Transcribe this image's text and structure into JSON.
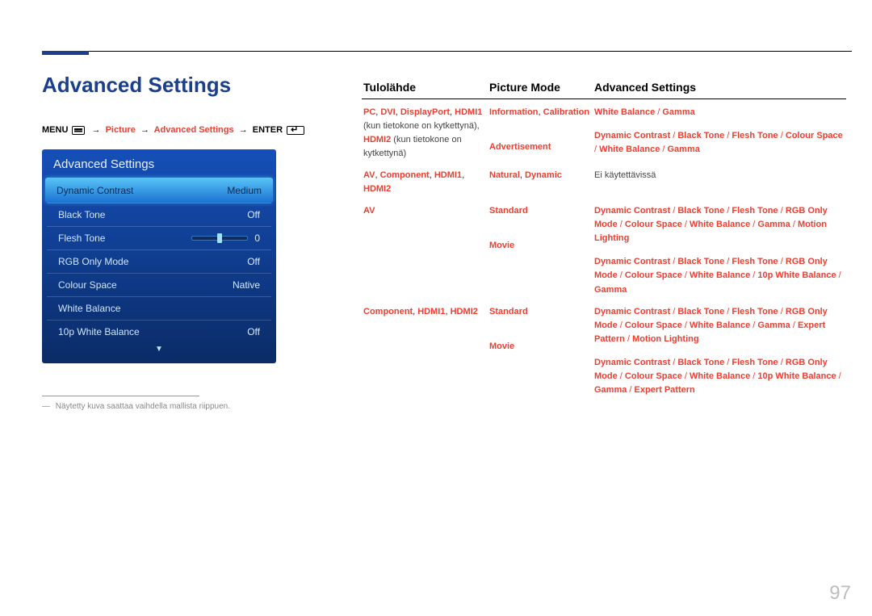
{
  "page": {
    "title": "Advanced Settings",
    "number": "97"
  },
  "breadcrumb": {
    "menu": "MENU",
    "c1": "Picture",
    "c2": "Advanced Settings",
    "enter": "ENTER"
  },
  "osd": {
    "title": "Advanced Settings",
    "rows": [
      {
        "label": "Dynamic Contrast",
        "value": "Medium",
        "hl": true
      },
      {
        "label": "Black Tone",
        "value": "Off"
      },
      {
        "label": "Flesh Tone",
        "value": "0",
        "slider": true
      },
      {
        "label": "RGB Only Mode",
        "value": "Off"
      },
      {
        "label": "Colour Space",
        "value": "Native"
      },
      {
        "label": "White Balance",
        "value": ""
      },
      {
        "label": "10p White Balance",
        "value": "Off"
      }
    ]
  },
  "footnote": "Näytetty kuva saattaa vaihdella mallista riippuen.",
  "table": {
    "headers": {
      "c1": "Tulolähde",
      "c2": "Picture Mode",
      "c3": "Advanced Settings"
    },
    "rows": [
      {
        "c1": "<b>PC</b>, <b>DVI</b>, <b>DisplayPort</b>, <b>HDMI1</b> <p>(kun tietokone on kytkettynä),</p> <b>HDMI2</b> <p>(kun tietokone on kytkettynä)</p>",
        "c2a": "<b>Information</b>, <b>Calibration</b>",
        "c3a": "<b>White Balance</b> / <b>Gamma</b>",
        "c2b": "<b>Advertisement</b>",
        "c3b": "<b>Dynamic Contrast</b> / <b>Black Tone</b> / <b>Flesh Tone</b> / <b>Colour Space</b> / <b>White Balance</b> / <b>Gamma</b>"
      },
      {
        "c1": "<b>AV</b>, <b>Component</b>, <b>HDMI1</b>, <b>HDMI2</b>",
        "c2a": "<b>Natural</b>, <b>Dynamic</b>",
        "c3a_plain": "Ei käytettävissä"
      },
      {
        "c1": "<b>AV</b>",
        "c2a": "<b>Standard</b>",
        "c3a": "<b>Dynamic Contrast</b> / <b>Black Tone</b> / <b>Flesh Tone</b> / <b>RGB Only Mode</b> / <b>Colour Space</b> / <b>White Balance</b> / <b>Gamma</b> / <b>Motion Lighting</b>",
        "c2b": "<b>Movie</b>",
        "c3b": "<b>Dynamic Contrast</b> / <b>Black Tone</b> / <b>Flesh Tone</b> / <b>RGB Only Mode</b> / <b>Colour Space</b> / <b>White Balance</b> / <b>10p White Balance</b> / <b>Gamma</b>"
      },
      {
        "c1": "<b>Component</b>, <b>HDMI1</b>, <b>HDMI2</b>",
        "c2a": "<b>Standard</b>",
        "c3a": "<b>Dynamic Contrast</b> / <b>Black Tone</b> / <b>Flesh Tone</b> / <b>RGB Only Mode</b> / <b>Colour Space</b> / <b>White Balance</b> / <b>Gamma</b> / <b>Expert Pattern</b> / <b>Motion Lighting</b>",
        "c2b": "<b>Movie</b>",
        "c3b": "<b>Dynamic Contrast</b> / <b>Black Tone</b> / <b>Flesh Tone</b> / <b>RGB Only Mode</b> / <b>Colour Space</b> / <b>White Balance</b> / <b>10p White Balance</b> / <b>Gamma</b> / <b>Expert Pattern</b>"
      }
    ]
  }
}
